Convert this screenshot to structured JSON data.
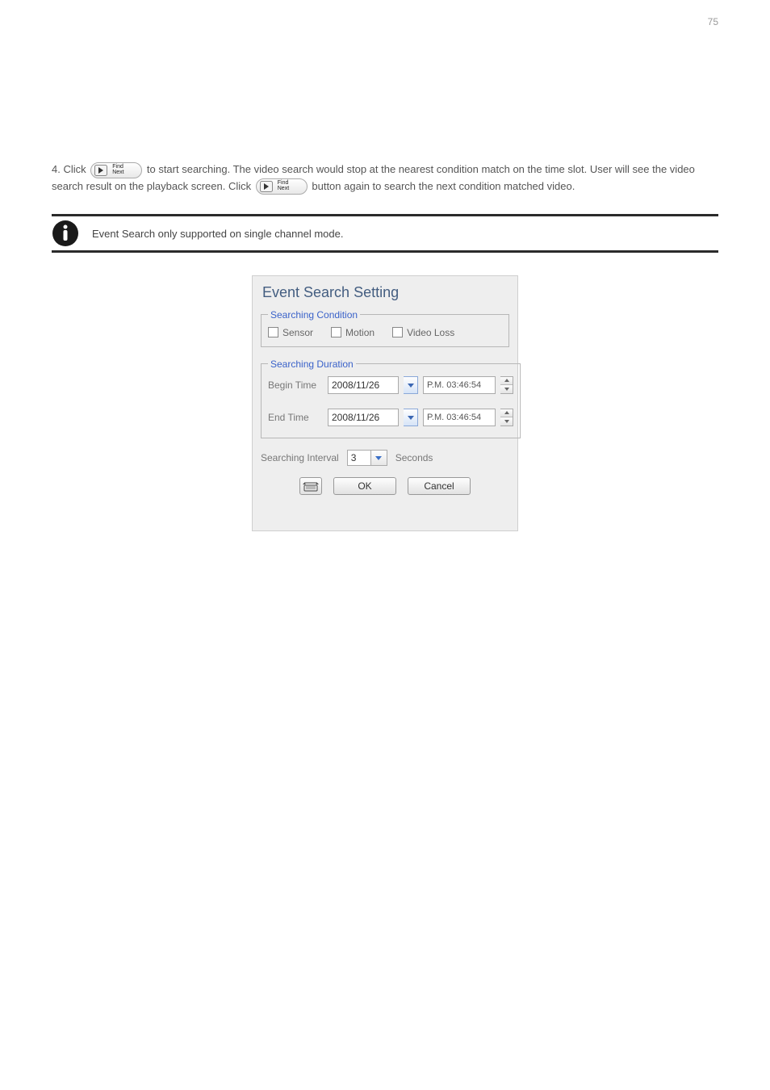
{
  "page_number": "75",
  "body_text": {
    "line1_pre": "4. Click ",
    "button_label": "Find Next",
    "line1_post": " to start searching. The video search would stop at the nearest condition",
    "line2": "match on the time slot. User will see the video search result on the playback screen.",
    "line3_pre": "Click ",
    "line3_post": " button again to search the next condition matched video."
  },
  "info_note": "Event Search only supported on single channel mode.",
  "dialog": {
    "title": "Event Search Setting",
    "cond": {
      "legend": "Searching Condition",
      "sensor": "Sensor",
      "motion": "Motion",
      "video_loss": "Video Loss"
    },
    "duration": {
      "legend": "Searching Duration",
      "begin_label": "Begin Time",
      "end_label": "End Time",
      "begin_date": "2008/11/26",
      "end_date": "2008/11/26",
      "begin_time": "P.M. 03:46:54",
      "end_time": "P.M. 03:46:54"
    },
    "interval": {
      "label": "Searching Interval",
      "value": "3",
      "unit": "Seconds"
    },
    "buttons": {
      "ok": "OK",
      "cancel": "Cancel"
    }
  }
}
